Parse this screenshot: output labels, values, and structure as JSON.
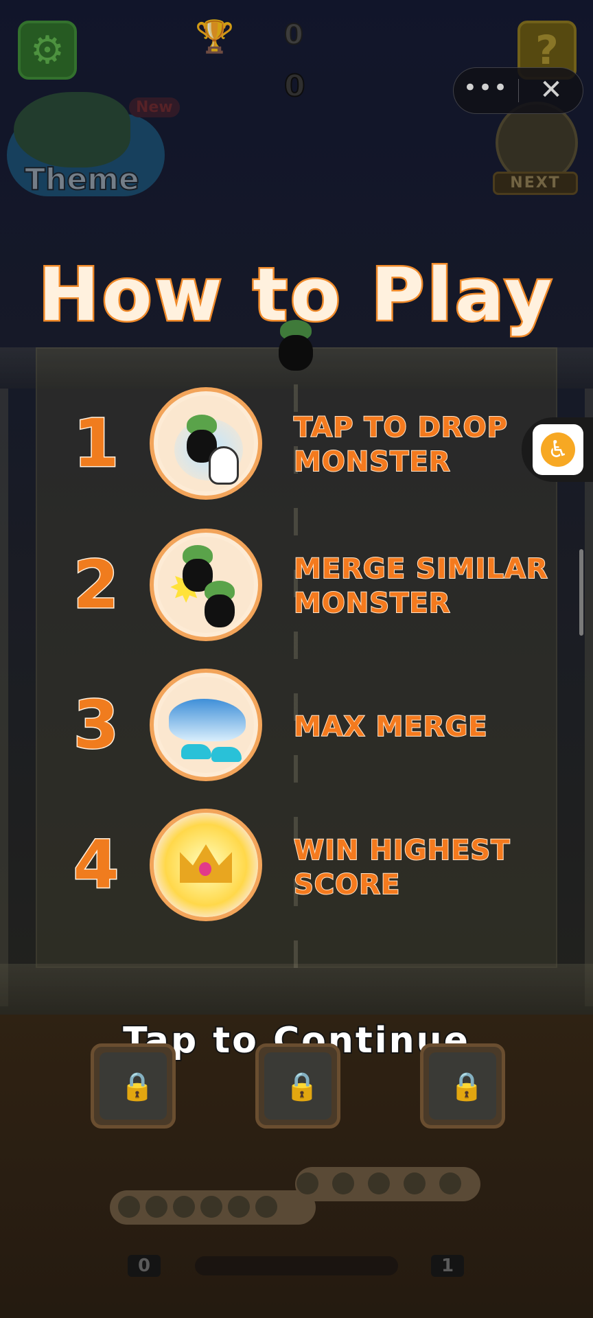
{
  "hud": {
    "best_score": "0",
    "current_score": "0",
    "help_symbol": "?",
    "theme_label": "Theme",
    "new_badge": "New",
    "next_label": "NEXT"
  },
  "capsule": {
    "more_symbol": "•••",
    "close_symbol": "✕"
  },
  "howto": {
    "title": "How to Play",
    "steps": [
      {
        "number": "1",
        "text_line1": "TAP TO DROP",
        "text_line2": "MONSTER",
        "icon": "tap-drop-icon"
      },
      {
        "number": "2",
        "text_line1": "MERGE SIMILAR",
        "text_line2": "MONSTER",
        "icon": "merge-icon"
      },
      {
        "number": "3",
        "text_line1": "MAX MERGE",
        "text_line2": "",
        "icon": "shark-icon"
      },
      {
        "number": "4",
        "text_line1": "WIN HIGHEST",
        "text_line2": "SCORE",
        "icon": "crown-icon"
      }
    ],
    "continue_label": "Tap to Continue"
  },
  "progress": {
    "level_from": "0",
    "level_to": "1"
  },
  "colors": {
    "accent_orange": "#f07c1e",
    "title_fill": "#fff1de"
  }
}
